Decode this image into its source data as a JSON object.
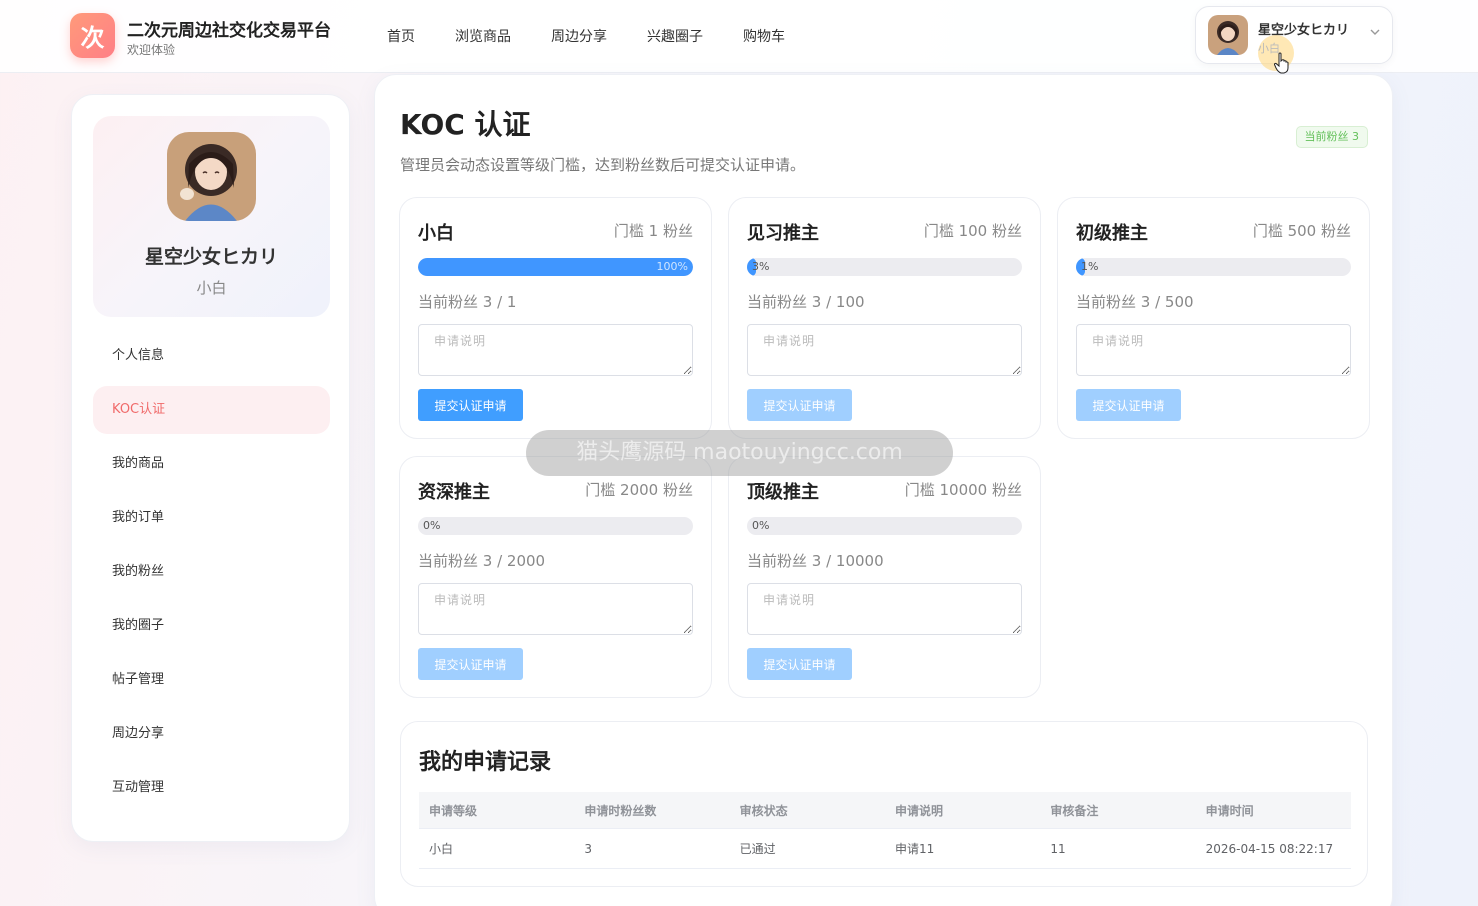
{
  "header": {
    "logo_char": "次",
    "title": "二次元周边社交化交易平台",
    "subtitle": "欢迎体验",
    "nav": [
      "首页",
      "浏览商品",
      "周边分享",
      "兴趣圈子",
      "购物车"
    ],
    "user": {
      "name": "星空少女ヒカリ",
      "level": "小白"
    }
  },
  "sidebar": {
    "profile": {
      "name": "星空少女ヒカリ",
      "level": "小白"
    },
    "items": [
      {
        "label": "个人信息",
        "active": false
      },
      {
        "label": "KOC认证",
        "active": true
      },
      {
        "label": "我的商品",
        "active": false
      },
      {
        "label": "我的订单",
        "active": false
      },
      {
        "label": "我的粉丝",
        "active": false
      },
      {
        "label": "我的圈子",
        "active": false
      },
      {
        "label": "帖子管理",
        "active": false
      },
      {
        "label": "周边分享",
        "active": false
      },
      {
        "label": "互动管理",
        "active": false
      }
    ]
  },
  "main": {
    "title": "KOC 认证",
    "description": "管理员会动态设置等级门槛，达到粉丝数后可提交认证申请。",
    "fan_badge": "当前粉丝 3",
    "levels": [
      {
        "name": "小白",
        "threshold": "门槛 1 粉丝",
        "progress_pct": 100,
        "progress_label": "100%",
        "current": "当前粉丝 3 / 1",
        "placeholder": "申请说明",
        "button": "提交认证申请",
        "enabled": true
      },
      {
        "name": "见习推主",
        "threshold": "门槛 100 粉丝",
        "progress_pct": 3,
        "progress_label": "3%",
        "current": "当前粉丝 3 / 100",
        "placeholder": "申请说明",
        "button": "提交认证申请",
        "enabled": false
      },
      {
        "name": "初级推主",
        "threshold": "门槛 500 粉丝",
        "progress_pct": 1,
        "progress_label": "1%",
        "current": "当前粉丝 3 / 500",
        "placeholder": "申请说明",
        "button": "提交认证申请",
        "enabled": false
      },
      {
        "name": "资深推主",
        "threshold": "门槛 2000 粉丝",
        "progress_pct": 0,
        "progress_label": "0%",
        "current": "当前粉丝 3 / 2000",
        "placeholder": "申请说明",
        "button": "提交认证申请",
        "enabled": false
      },
      {
        "name": "顶级推主",
        "threshold": "门槛 10000 粉丝",
        "progress_pct": 0,
        "progress_label": "0%",
        "current": "当前粉丝 3 / 10000",
        "placeholder": "申请说明",
        "button": "提交认证申请",
        "enabled": false
      }
    ],
    "records": {
      "title": "我的申请记录",
      "columns": [
        "申请等级",
        "申请时粉丝数",
        "审核状态",
        "申请说明",
        "审核备注",
        "申请时间"
      ],
      "rows": [
        [
          "小白",
          "3",
          "已通过",
          "申请11",
          "11",
          "2026-04-15 08:22:17"
        ]
      ]
    }
  },
  "watermark": "猫头鹰源码 maotouyingcc.com",
  "colors": {
    "primary": "#409eff",
    "primary_disabled": "#a0cfff",
    "accent": "#f06a6a",
    "badge_green": "#63c05a"
  }
}
